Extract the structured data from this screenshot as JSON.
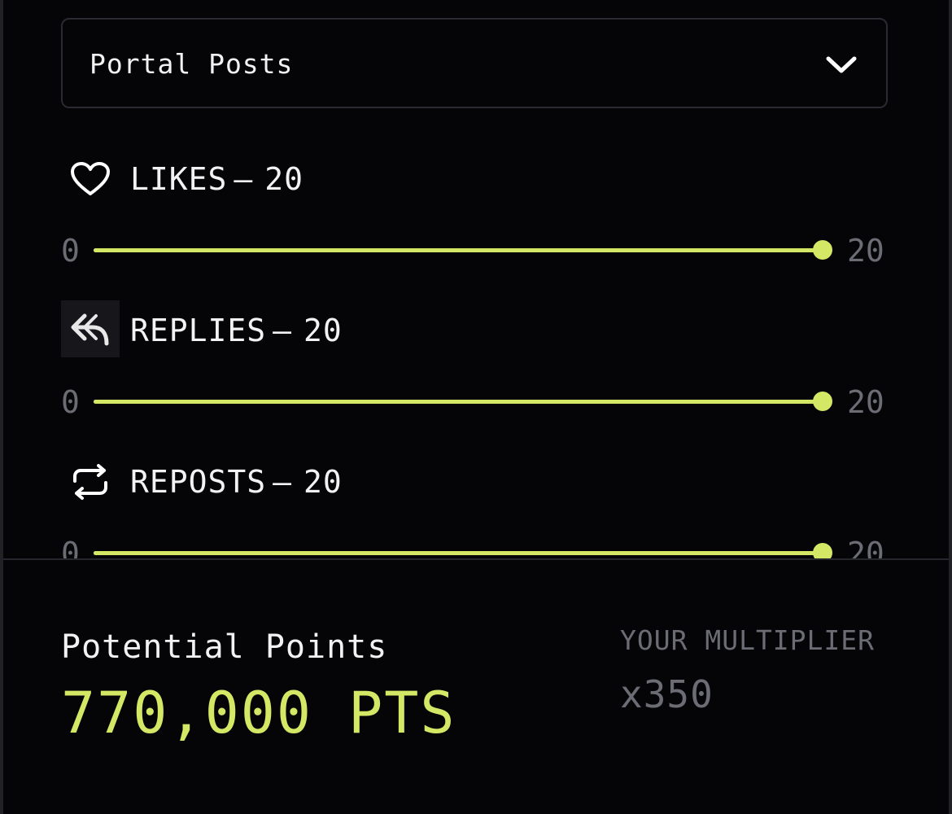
{
  "filter": {
    "selected": "Portal Posts"
  },
  "metrics": [
    {
      "icon": "heart-icon",
      "label": "LIKES",
      "sep": "–",
      "value": "20",
      "min": "0",
      "max": "20",
      "fraction": 1.0
    },
    {
      "icon": "reply-icon",
      "label": "REPLIES",
      "sep": "–",
      "value": "20",
      "min": "0",
      "max": "20",
      "fraction": 1.0
    },
    {
      "icon": "repost-icon",
      "label": "REPOSTS",
      "sep": "–",
      "value": "20",
      "min": "0",
      "max": "20",
      "fraction": 1.0
    }
  ],
  "summary": {
    "potential_label": "Potential Points",
    "potential_value": "770,000 PTS",
    "multiplier_label": "YOUR MULTIPLIER",
    "multiplier_value": "x350"
  },
  "colors": {
    "accent": "#d4e865",
    "background": "#050508",
    "muted": "#6b6c74",
    "text": "#f2f2f2"
  }
}
